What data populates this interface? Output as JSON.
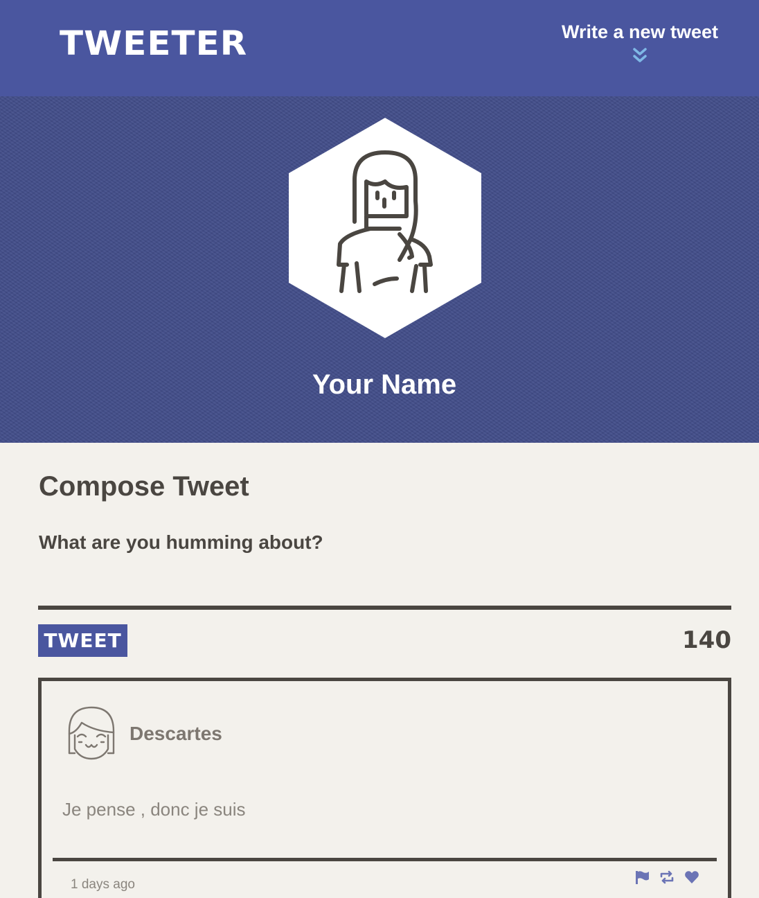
{
  "nav": {
    "logo": "TWEETER",
    "compose_toggle_label": "Write a new tweet",
    "compose_toggle_icon": "double-chevron-down-icon"
  },
  "profile": {
    "name": "Your Name",
    "avatar_icon": "woman-avatar-icon"
  },
  "compose": {
    "title": "Compose Tweet",
    "prompt": "What are you humming about?",
    "textarea_value": "",
    "button_label": "TWEET",
    "char_count": "140"
  },
  "tweets": [
    {
      "author": "Descartes",
      "avatar_icon": "smiling-face-avatar-icon",
      "text": "Je pense , donc je suis",
      "time": "1 days ago",
      "actions": [
        "flag-icon",
        "retweet-icon",
        "heart-icon"
      ]
    }
  ],
  "colors": {
    "nav_bg": "#4a569f",
    "profile_bg": "#424d89",
    "page_bg": "#f3f1ec",
    "text_dark": "#4a4641",
    "accent_light": "#7fb8e6",
    "action_icon": "#6b74b5"
  }
}
